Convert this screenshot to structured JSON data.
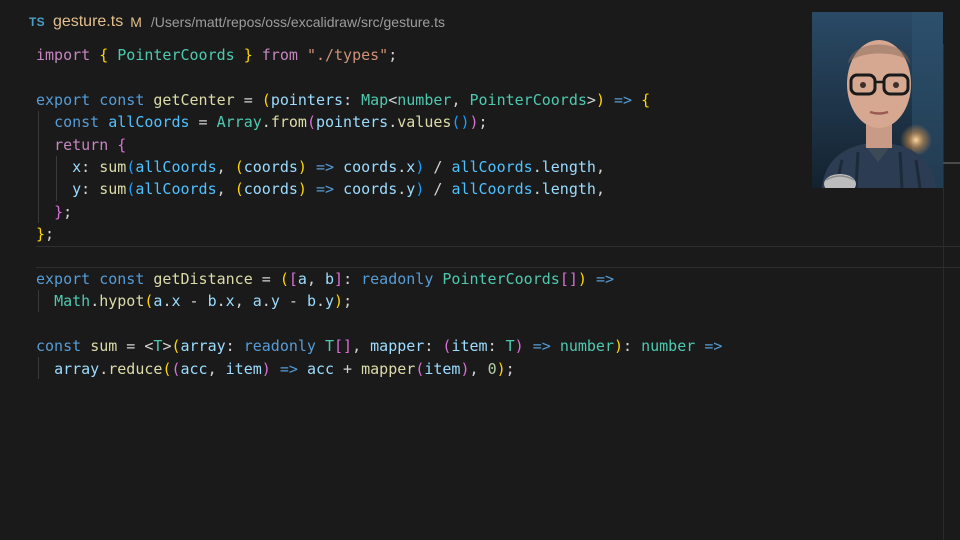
{
  "titlebar": {
    "language_badge": "TS",
    "file_name": "gesture.ts",
    "modified_badge": "M",
    "file_path": "/Users/matt/repos/oss/excalidraw/src/gesture.ts"
  },
  "editor": {
    "language": "typescript",
    "lines": [
      [
        [
          "kw",
          "import"
        ],
        [
          "p",
          " "
        ],
        [
          "b1",
          "{"
        ],
        [
          "p",
          " "
        ],
        [
          "ty",
          "PointerCoords"
        ],
        [
          "p",
          " "
        ],
        [
          "b1",
          "}"
        ],
        [
          "p",
          " "
        ],
        [
          "kw",
          "from"
        ],
        [
          "p",
          " "
        ],
        [
          "str",
          "\"./types\""
        ],
        [
          "p",
          ";"
        ]
      ],
      [],
      [
        [
          "st",
          "export"
        ],
        [
          "p",
          " "
        ],
        [
          "st",
          "const"
        ],
        [
          "p",
          " "
        ],
        [
          "fn",
          "getCenter"
        ],
        [
          "p",
          " = "
        ],
        [
          "b1",
          "("
        ],
        [
          "vr",
          "pointers"
        ],
        [
          "p",
          ": "
        ],
        [
          "ty",
          "Map"
        ],
        [
          "p",
          "<"
        ],
        [
          "ty",
          "number"
        ],
        [
          "p",
          ", "
        ],
        [
          "ty",
          "PointerCoords"
        ],
        [
          "p",
          ">"
        ],
        [
          "b1",
          ")"
        ],
        [
          "p",
          " "
        ],
        [
          "st",
          "=>"
        ],
        [
          "p",
          " "
        ],
        [
          "b1",
          "{"
        ]
      ],
      [
        [
          "p",
          "  "
        ],
        [
          "st",
          "const"
        ],
        [
          "p",
          " "
        ],
        [
          "cs",
          "allCoords"
        ],
        [
          "p",
          " = "
        ],
        [
          "ty",
          "Array"
        ],
        [
          "p",
          "."
        ],
        [
          "fn",
          "from"
        ],
        [
          "b2",
          "("
        ],
        [
          "vr",
          "pointers"
        ],
        [
          "p",
          "."
        ],
        [
          "fn",
          "values"
        ],
        [
          "b3",
          "()"
        ],
        [
          "b2",
          ")"
        ],
        [
          "p",
          ";"
        ]
      ],
      [
        [
          "p",
          "  "
        ],
        [
          "kw",
          "return"
        ],
        [
          "p",
          " "
        ],
        [
          "b2",
          "{"
        ]
      ],
      [
        [
          "p",
          "    "
        ],
        [
          "vr",
          "x"
        ],
        [
          "p",
          ": "
        ],
        [
          "fn",
          "sum"
        ],
        [
          "b3",
          "("
        ],
        [
          "cs",
          "allCoords"
        ],
        [
          "p",
          ", "
        ],
        [
          "b1",
          "("
        ],
        [
          "vr",
          "coords"
        ],
        [
          "b1",
          ")"
        ],
        [
          "p",
          " "
        ],
        [
          "st",
          "=>"
        ],
        [
          "p",
          " "
        ],
        [
          "vr",
          "coords"
        ],
        [
          "p",
          "."
        ],
        [
          "vr",
          "x"
        ],
        [
          "b3",
          ")"
        ],
        [
          "p",
          " / "
        ],
        [
          "cs",
          "allCoords"
        ],
        [
          "p",
          "."
        ],
        [
          "vr",
          "length"
        ],
        [
          "p",
          ","
        ]
      ],
      [
        [
          "p",
          "    "
        ],
        [
          "vr",
          "y"
        ],
        [
          "p",
          ": "
        ],
        [
          "fn",
          "sum"
        ],
        [
          "b3",
          "("
        ],
        [
          "cs",
          "allCoords"
        ],
        [
          "p",
          ", "
        ],
        [
          "b1",
          "("
        ],
        [
          "vr",
          "coords"
        ],
        [
          "b1",
          ")"
        ],
        [
          "p",
          " "
        ],
        [
          "st",
          "=>"
        ],
        [
          "p",
          " "
        ],
        [
          "vr",
          "coords"
        ],
        [
          "p",
          "."
        ],
        [
          "vr",
          "y"
        ],
        [
          "b3",
          ")"
        ],
        [
          "p",
          " / "
        ],
        [
          "cs",
          "allCoords"
        ],
        [
          "p",
          "."
        ],
        [
          "vr",
          "length"
        ],
        [
          "p",
          ","
        ]
      ],
      [
        [
          "p",
          "  "
        ],
        [
          "b2",
          "}"
        ],
        [
          "p",
          ";"
        ]
      ],
      [
        [
          "b1",
          "}"
        ],
        [
          "p",
          ";"
        ]
      ],
      [],
      [
        [
          "st",
          "export"
        ],
        [
          "p",
          " "
        ],
        [
          "st",
          "const"
        ],
        [
          "p",
          " "
        ],
        [
          "fn",
          "getDistance"
        ],
        [
          "p",
          " = "
        ],
        [
          "b1",
          "("
        ],
        [
          "b2",
          "["
        ],
        [
          "vr",
          "a"
        ],
        [
          "p",
          ", "
        ],
        [
          "vr",
          "b"
        ],
        [
          "b2",
          "]"
        ],
        [
          "p",
          ": "
        ],
        [
          "st",
          "readonly"
        ],
        [
          "p",
          " "
        ],
        [
          "ty",
          "PointerCoords"
        ],
        [
          "b2",
          "[]"
        ],
        [
          "b1",
          ")"
        ],
        [
          "p",
          " "
        ],
        [
          "st",
          "=>"
        ]
      ],
      [
        [
          "p",
          "  "
        ],
        [
          "ty",
          "Math"
        ],
        [
          "p",
          "."
        ],
        [
          "fn",
          "hypot"
        ],
        [
          "b1",
          "("
        ],
        [
          "vr",
          "a"
        ],
        [
          "p",
          "."
        ],
        [
          "vr",
          "x"
        ],
        [
          "p",
          " - "
        ],
        [
          "vr",
          "b"
        ],
        [
          "p",
          "."
        ],
        [
          "vr",
          "x"
        ],
        [
          "p",
          ", "
        ],
        [
          "vr",
          "a"
        ],
        [
          "p",
          "."
        ],
        [
          "vr",
          "y"
        ],
        [
          "p",
          " - "
        ],
        [
          "vr",
          "b"
        ],
        [
          "p",
          "."
        ],
        [
          "vr",
          "y"
        ],
        [
          "b1",
          ")"
        ],
        [
          "p",
          ";"
        ]
      ],
      [],
      [
        [
          "st",
          "const"
        ],
        [
          "p",
          " "
        ],
        [
          "fn",
          "sum"
        ],
        [
          "p",
          " = "
        ],
        [
          "p",
          "<"
        ],
        [
          "ty",
          "T"
        ],
        [
          "p",
          ">"
        ],
        [
          "b1",
          "("
        ],
        [
          "vr",
          "array"
        ],
        [
          "p",
          ": "
        ],
        [
          "st",
          "readonly"
        ],
        [
          "p",
          " "
        ],
        [
          "ty",
          "T"
        ],
        [
          "b2",
          "[]"
        ],
        [
          "p",
          ", "
        ],
        [
          "vr",
          "mapper"
        ],
        [
          "p",
          ": "
        ],
        [
          "b2",
          "("
        ],
        [
          "vr",
          "item"
        ],
        [
          "p",
          ": "
        ],
        [
          "ty",
          "T"
        ],
        [
          "b2",
          ")"
        ],
        [
          "p",
          " "
        ],
        [
          "st",
          "=>"
        ],
        [
          "p",
          " "
        ],
        [
          "ty",
          "number"
        ],
        [
          "b1",
          ")"
        ],
        [
          "p",
          ": "
        ],
        [
          "ty",
          "number"
        ],
        [
          "p",
          " "
        ],
        [
          "st",
          "=>"
        ]
      ],
      [
        [
          "p",
          "  "
        ],
        [
          "vr",
          "array"
        ],
        [
          "p",
          "."
        ],
        [
          "fn",
          "reduce"
        ],
        [
          "b1",
          "("
        ],
        [
          "b2",
          "("
        ],
        [
          "vr",
          "acc"
        ],
        [
          "p",
          ", "
        ],
        [
          "vr",
          "item"
        ],
        [
          "b2",
          ")"
        ],
        [
          "p",
          " "
        ],
        [
          "st",
          "=>"
        ],
        [
          "p",
          " "
        ],
        [
          "vr",
          "acc"
        ],
        [
          "p",
          " + "
        ],
        [
          "fn",
          "mapper"
        ],
        [
          "b2",
          "("
        ],
        [
          "vr",
          "item"
        ],
        [
          "b2",
          ")"
        ],
        [
          "p",
          ", "
        ],
        [
          "num",
          "0"
        ],
        [
          "b1",
          ")"
        ],
        [
          "p",
          ";"
        ]
      ]
    ]
  },
  "token_colors": {
    "keyword_control": "#c586c0",
    "storage": "#569cd6",
    "function": "#dcdcaa",
    "variable": "#9cdcfe",
    "constant": "#4fc1ff",
    "type": "#4ec9b0",
    "string": "#ce9178",
    "number": "#b5cea8",
    "bracket_level_1": "#ffd700",
    "bracket_level_2": "#da70d6",
    "bracket_level_3": "#179fff"
  },
  "webcam": {
    "content": "presenter-video"
  }
}
